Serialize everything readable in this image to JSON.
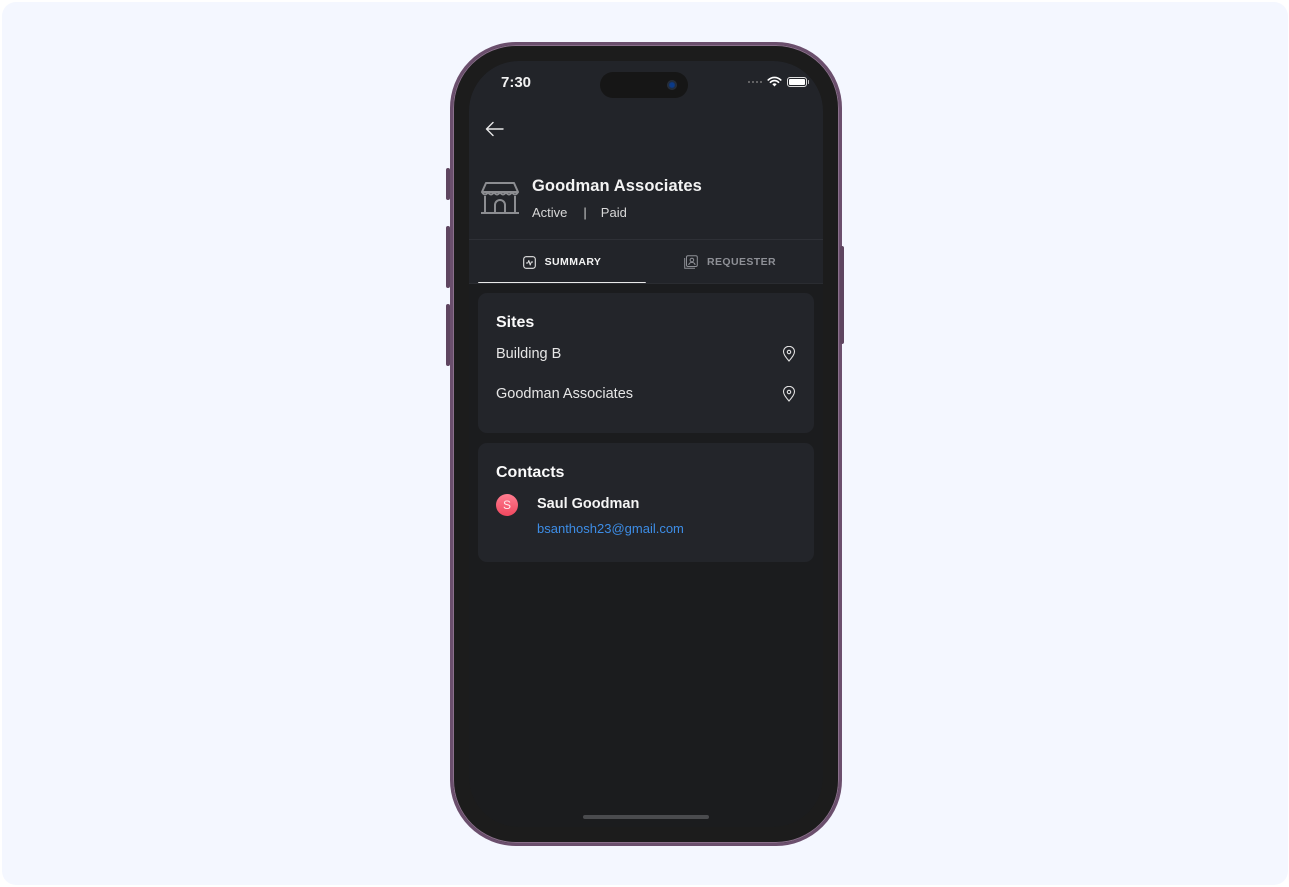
{
  "status_bar": {
    "time": "7:30",
    "icons": [
      "signal-dots-icon",
      "wifi-icon",
      "battery-icon"
    ]
  },
  "header": {
    "back_icon": "arrow-left-icon",
    "company_icon": "storefront-icon",
    "company_name": "Goodman Associates",
    "status": "Active",
    "separator": "|",
    "payment_status": "Paid"
  },
  "tabs": [
    {
      "label": "SUMMARY",
      "icon": "activity-chart-icon",
      "active": true
    },
    {
      "label": "REQUESTER",
      "icon": "contact-card-icon",
      "active": false
    }
  ],
  "sites": {
    "title": "Sites",
    "items": [
      {
        "label": "Building B",
        "icon": "map-pin-icon"
      },
      {
        "label": "Goodman Associates",
        "icon": "map-pin-icon"
      }
    ]
  },
  "contacts": {
    "title": "Contacts",
    "items": [
      {
        "initial": "S",
        "name": "Saul Goodman",
        "email": "bsanthosh23@gmail.com"
      }
    ]
  },
  "colors": {
    "background": "#f4f7ff",
    "screen": "#1b1c1e",
    "card": "#23252a",
    "link": "#3d8de6",
    "avatar": "#f0485f",
    "frame": "#6b4f6d"
  }
}
